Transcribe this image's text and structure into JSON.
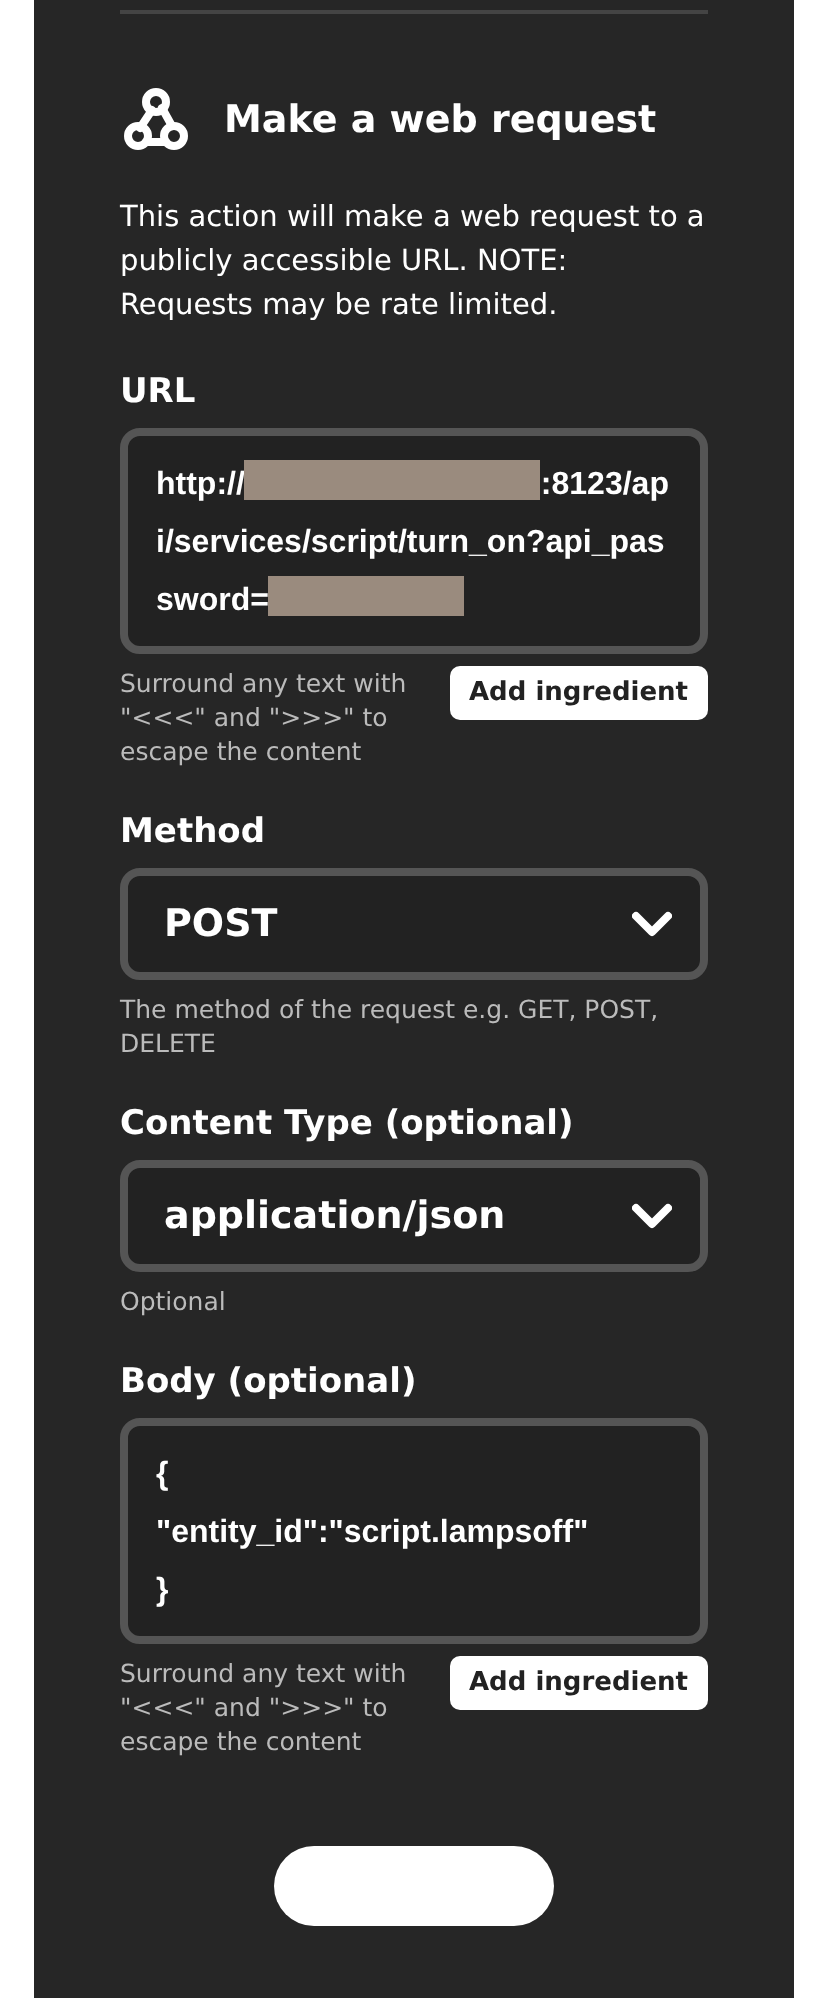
{
  "action": {
    "title": "Make a web request",
    "description": "This action will make a web request to a publicly accessible URL. NOTE: Requests may be rate limited."
  },
  "fields": [
    {
      "kind": "text",
      "label": "URL",
      "segments": [
        {
          "kind": "text",
          "text": "http://"
        },
        {
          "kind": "redacted"
        },
        {
          "kind": "text",
          "text": ":8123/api/services/script/turn_on?api_password="
        },
        {
          "kind": "redacted"
        }
      ],
      "hint": "Surround any text with \"<<<\" and \">>>\" to escape the content",
      "button": "Add ingredient"
    },
    {
      "kind": "select",
      "label": "Method",
      "value": "POST",
      "hint": "The method of the request e.g. GET, POST, DELETE"
    },
    {
      "kind": "select",
      "label": "Content Type (optional)",
      "value": "application/json",
      "hint": "Optional"
    },
    {
      "kind": "text",
      "label": "Body (optional)",
      "segments": [
        {
          "kind": "text",
          "text": "{\n\"entity_id\":\"script.lampsoff\"\n}"
        }
      ],
      "hint": "Surround any text with \"<<<\" and \">>>\" to escape the content",
      "button": "Add ingredient"
    }
  ]
}
